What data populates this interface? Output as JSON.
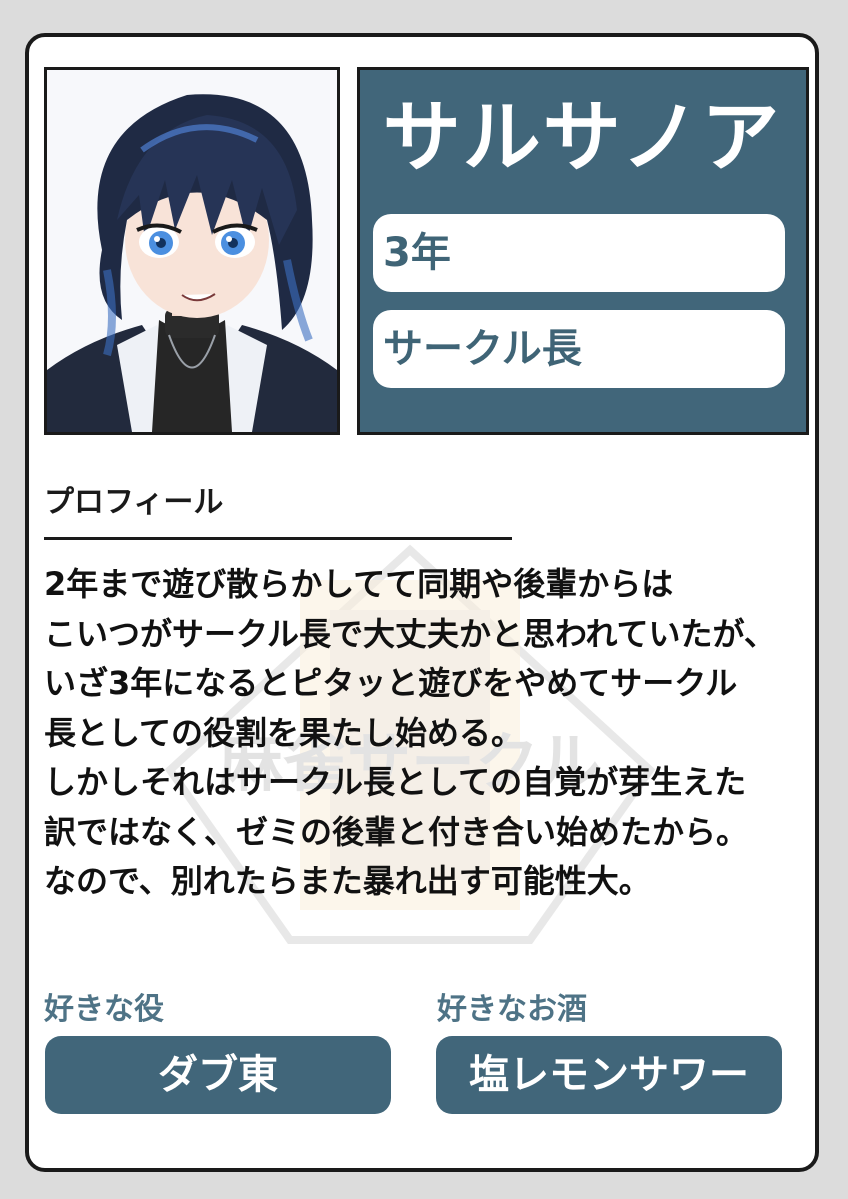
{
  "character": {
    "name": "サルサノア",
    "year": "3年",
    "position": "サークル長"
  },
  "profile": {
    "heading": "プロフィール",
    "lines": [
      "2年まで遊び散らかしてて同期や後輩からは",
      "こいつがサークル長で大丈夫かと思われていたが、",
      "いざ3年になるとピタッと遊びをやめてサークル",
      "長としての役割を果たし始める。",
      "しかしそれはサークル長としての自覚が芽生えた",
      "訳ではなく、ゼミの後輩と付き合い始めたから。",
      "なので、別れたらまた暴れ出す可能性大。"
    ]
  },
  "favorites": {
    "role_label": "好きな役",
    "role_value": "ダブ東",
    "drink_label": "好きなお酒",
    "drink_value": "塩レモンサワー"
  },
  "watermark_text": "麻雀サークル",
  "colors": {
    "panel": "#41667a",
    "label": "#4e7386",
    "border": "#1a1a1a",
    "background": "#dcdcdc"
  }
}
